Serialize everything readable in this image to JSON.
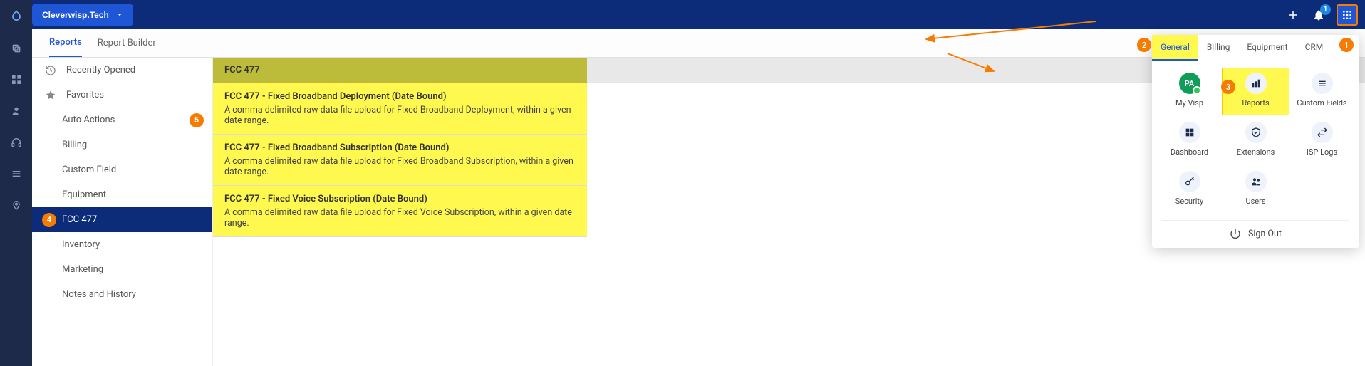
{
  "header": {
    "tenant": "Cleverwisp.Tech",
    "bell_badge": "1"
  },
  "subheader": {
    "tabs": [
      "Reports",
      "Report Builder"
    ],
    "active": 0
  },
  "sidebar": {
    "items": [
      {
        "label": "Recently Opened",
        "icon": "history"
      },
      {
        "label": "Favorites",
        "icon": "star"
      },
      {
        "label": "Auto Actions",
        "sub": true,
        "badge": "5"
      },
      {
        "label": "Billing",
        "sub": true
      },
      {
        "label": "Custom Field",
        "sub": true
      },
      {
        "label": "Equipment",
        "sub": true
      },
      {
        "label": "FCC 477",
        "sub": true,
        "active": true,
        "badge": "4",
        "badge_left": true
      },
      {
        "label": "Inventory",
        "sub": true
      },
      {
        "label": "Marketing",
        "sub": true
      },
      {
        "label": "Notes and History",
        "sub": true
      }
    ]
  },
  "content": {
    "header": "FCC 477",
    "rows": [
      {
        "title": "FCC 477 - Fixed Broadband Deployment (Date Bound)",
        "desc": "A comma delimited raw data file upload for Fixed Broadband Deployment, within a given date range."
      },
      {
        "title": "FCC 477 - Fixed Broadband Subscription (Date Bound)",
        "desc": "A comma delimited raw data file upload for Fixed Broadband Subscription, within a given date range."
      },
      {
        "title": "FCC 477 - Fixed Voice Subscription (Date Bound)",
        "desc": "A comma delimited raw data file upload for Fixed Voice Subscription, within a given date range."
      }
    ]
  },
  "popover": {
    "tabs": [
      "General",
      "Billing",
      "Equipment",
      "CRM"
    ],
    "active": 0,
    "grid": [
      {
        "label": "My Visp",
        "avatar": "PA"
      },
      {
        "label": "Reports",
        "hl": true,
        "badge": "3"
      },
      {
        "label": "Custom Fields"
      },
      {
        "label": "Dashboard"
      },
      {
        "label": "Extensions"
      },
      {
        "label": "ISP Logs"
      },
      {
        "label": "Security"
      },
      {
        "label": "Users"
      }
    ],
    "signout": "Sign Out"
  },
  "annotations": {
    "b1": "1",
    "b2": "2",
    "b3": "3"
  }
}
